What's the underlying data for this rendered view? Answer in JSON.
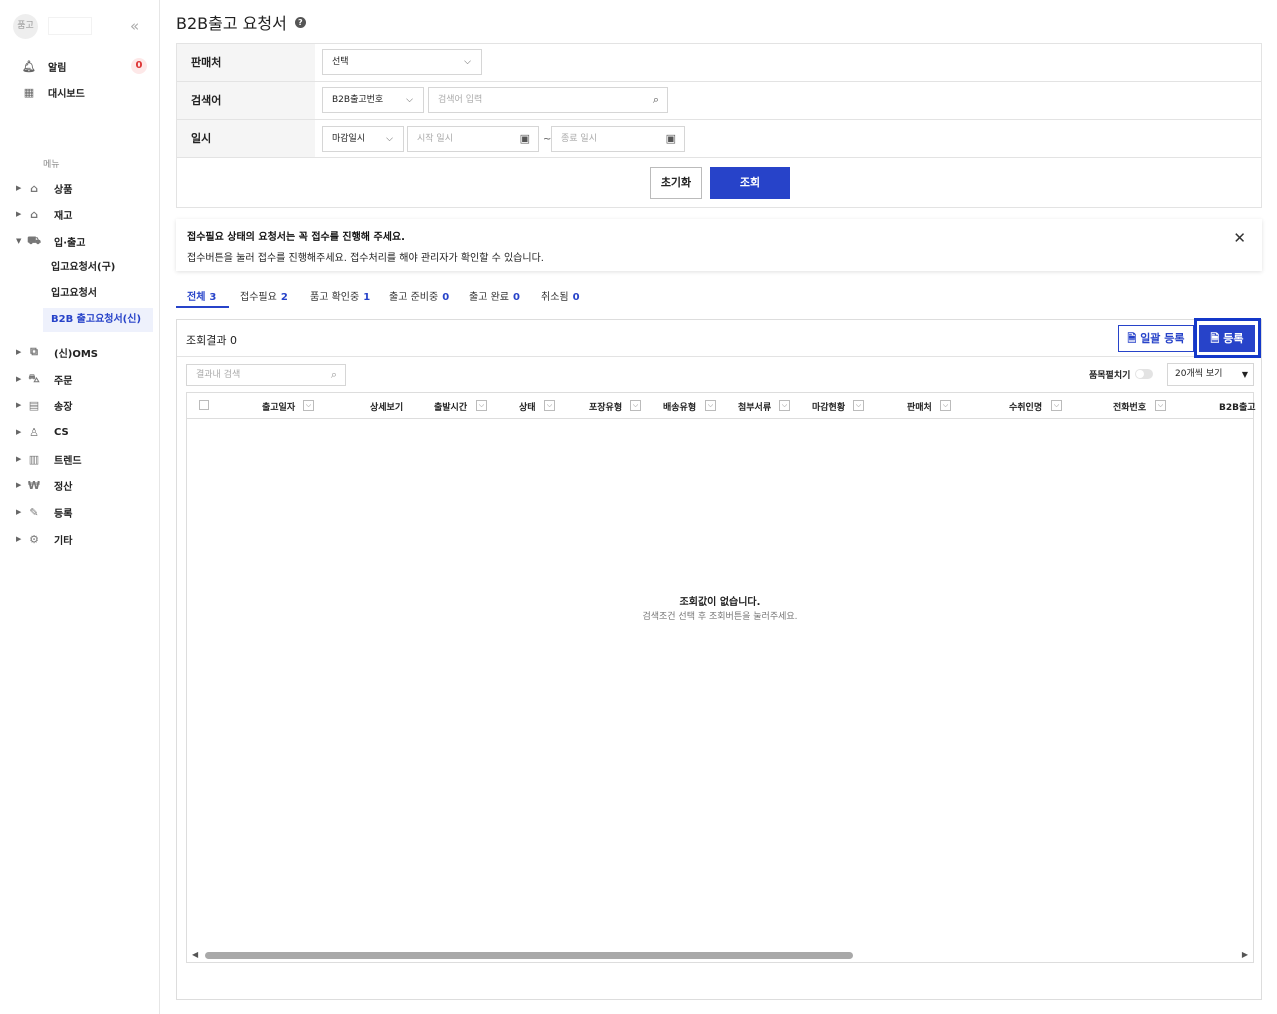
{
  "sidebar": {
    "avatar_text": "품고",
    "collapse_icon": "«",
    "top_items": [
      {
        "label": "알림",
        "icon": "bell-icon",
        "badge": "0"
      },
      {
        "label": "대시보드",
        "icon": "dashboard-icon"
      }
    ],
    "section_label": "메뉴",
    "menu": [
      {
        "label": "상품",
        "icon": "bag-icon"
      },
      {
        "label": "재고",
        "icon": "warehouse-icon"
      },
      {
        "label": "입·출고",
        "icon": "truck-icon",
        "expanded": true
      },
      {
        "label": "(신)OMS",
        "icon": "oms-icon"
      },
      {
        "label": "주문",
        "icon": "cart-icon"
      },
      {
        "label": "송장",
        "icon": "invoice-icon"
      },
      {
        "label": "CS",
        "icon": "person-icon"
      },
      {
        "label": "트렌드",
        "icon": "chart-icon"
      },
      {
        "label": "정산",
        "icon": "won-icon"
      },
      {
        "label": "등록",
        "icon": "pencil-icon"
      },
      {
        "label": "기타",
        "icon": "gear-icon"
      }
    ],
    "submenu": [
      {
        "label": "입고요청서(구)"
      },
      {
        "label": "입고요청서"
      },
      {
        "label": "B2B 출고요청서(신)",
        "active": true
      }
    ]
  },
  "page": {
    "title": "B2B출고 요청서",
    "help_icon": "?"
  },
  "filter": {
    "seller_label": "판매처",
    "seller_value": "선택",
    "keyword_label": "검색어",
    "keyword_type": "B2B출고번호",
    "keyword_placeholder": "검색어 입력",
    "date_label": "일시",
    "date_type": "마감일시",
    "start_placeholder": "시작 일시",
    "tilde": "~",
    "end_placeholder": "종료 일시",
    "reset_label": "초기화",
    "search_label": "조회"
  },
  "notice": {
    "line1": "접수필요 상태의 요청서는 꼭 접수를 진행해 주세요.",
    "line2": "접수버튼을 눌러 접수를 진행해주세요. 접수처리를 해야 관리자가 확인할 수 있습니다.",
    "close": "✕"
  },
  "tabs": [
    {
      "label": "전체",
      "count": "3",
      "active": true
    },
    {
      "label": "접수필요",
      "count": "2"
    },
    {
      "label": "품고 확인중",
      "count": "1"
    },
    {
      "label": "출고 준비중",
      "count": "0"
    },
    {
      "label": "출고 완료",
      "count": "0"
    },
    {
      "label": "취소됨",
      "count": "0"
    }
  ],
  "results": {
    "label": "조회결과 0",
    "bulk_register": "일괄 등록",
    "register": "등록",
    "inner_search_placeholder": "결과내 검색",
    "fix_columns_label": "품목펼치기",
    "per_page": "20개씩 보기"
  },
  "table": {
    "columns": [
      "출고일자",
      "상세보기",
      "출발시간",
      "상태",
      "포장유형",
      "배송유형",
      "첨부서류",
      "마감현황",
      "판매처",
      "수취인명",
      "전화번호",
      "B2B출고"
    ],
    "empty_title": "조회값이 없습니다.",
    "empty_sub": "검색조건 선택 후 조회버튼을 눌러주세요."
  },
  "colors": {
    "accent": "#2743c9",
    "highlight": "#1438c9"
  }
}
